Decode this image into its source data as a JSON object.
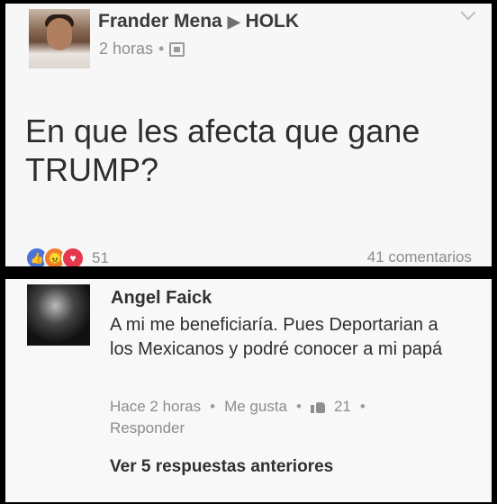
{
  "post": {
    "author": "Frander Mena",
    "target": "HOLK",
    "time": "2 horas",
    "text": "En que les afecta que gane TRUMP?",
    "reactions_count": "51",
    "comments_count": "41 comentarios"
  },
  "comment": {
    "author": "Angel Faick",
    "text": "A mi me beneficiaría. Pues Deportarian a los Mexicanos y podré conocer a mi papá",
    "time": "Hace 2 horas",
    "like_label": "Me gusta",
    "likes": "21",
    "reply_label": "Responder",
    "more_replies": "Ver 5 respuestas anteriores"
  },
  "icons": [
    "globe-icon",
    "like-reaction-icon",
    "angry-reaction-icon",
    "love-reaction-icon",
    "thumbs-up-icon",
    "chevron-down-icon"
  ],
  "colors": {
    "like_blue": "#4a75d6",
    "angry_orange": "#ef7a2d",
    "love_red": "#e5384d"
  }
}
